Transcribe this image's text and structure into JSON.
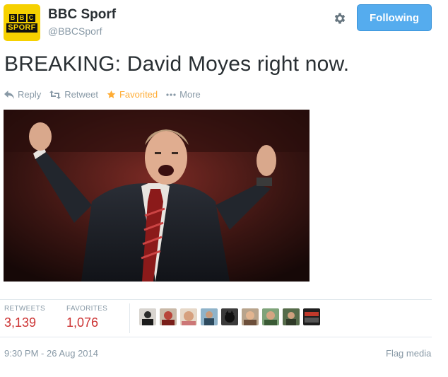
{
  "header": {
    "avatar": {
      "logo_blocks": [
        "B",
        "B",
        "C"
      ],
      "logo_word": "SPORF",
      "brand_color": "#f6d100"
    },
    "display_name": "BBC Sporf",
    "handle": "@BBCSporf",
    "follow_button_label": "Following",
    "settings_icon": "gear-icon"
  },
  "tweet": {
    "text": "BREAKING: David Moyes right now."
  },
  "actions": [
    {
      "label": "Reply",
      "icon": "reply-icon"
    },
    {
      "label": "Retweet",
      "icon": "retweet-icon"
    },
    {
      "label": "Favorited",
      "icon": "star-icon",
      "active": true
    },
    {
      "label": "More",
      "icon": "ellipsis-icon"
    }
  ],
  "stats": {
    "retweets_label": "RETWEETS",
    "retweets_value": "3,139",
    "favorites_label": "FAVORITES",
    "favorites_value": "1,076",
    "stat_color": "#cc3333"
  },
  "footer": {
    "timestamp": "9:30 PM - 26 Aug 2014",
    "flag_media_label": "Flag media"
  },
  "colors": {
    "accent": "#55acee",
    "favorited": "#ffac33",
    "muted": "#8899a6"
  }
}
